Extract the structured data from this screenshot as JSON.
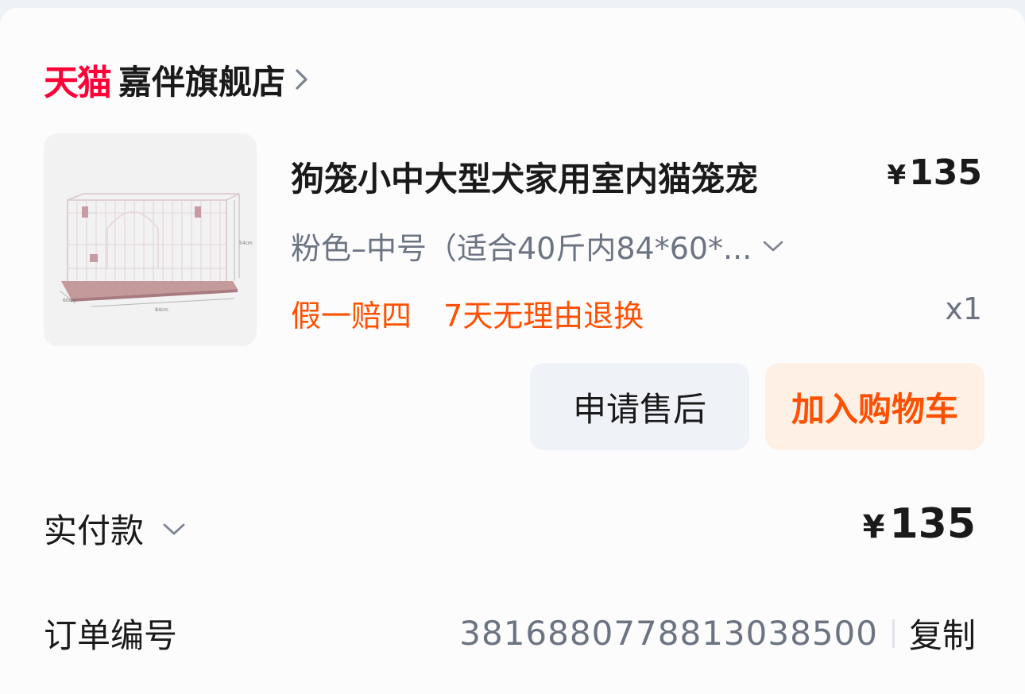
{
  "shop": {
    "platform_logo": "天猫",
    "name": "嘉伴旗舰店",
    "chevron": "chevron-right-icon"
  },
  "item": {
    "image": {
      "dims": [
        "54cm",
        "60cm",
        "84cm"
      ],
      "color": "#c49a9a"
    },
    "title": "狗笼小中大型犬家用室内猫笼宠",
    "price_symbol": "¥",
    "price": "135",
    "sku": "粉色–中号（适合40斤内84*60*...",
    "promo_1": "假一赔四",
    "promo_2": "7天无理由退换",
    "quantity": "x1"
  },
  "actions": {
    "after_sale": "申请售后",
    "add_to_cart": "加入购物车"
  },
  "payment": {
    "label": "实付款",
    "symbol": "¥",
    "amount": "135"
  },
  "order": {
    "label": "订单编号",
    "number": "3816880778813038500",
    "copy": "复制"
  },
  "colors": {
    "tmall_red": "#ff0036",
    "accent_orange": "#ff5000",
    "muted_text": "#6c7381"
  }
}
